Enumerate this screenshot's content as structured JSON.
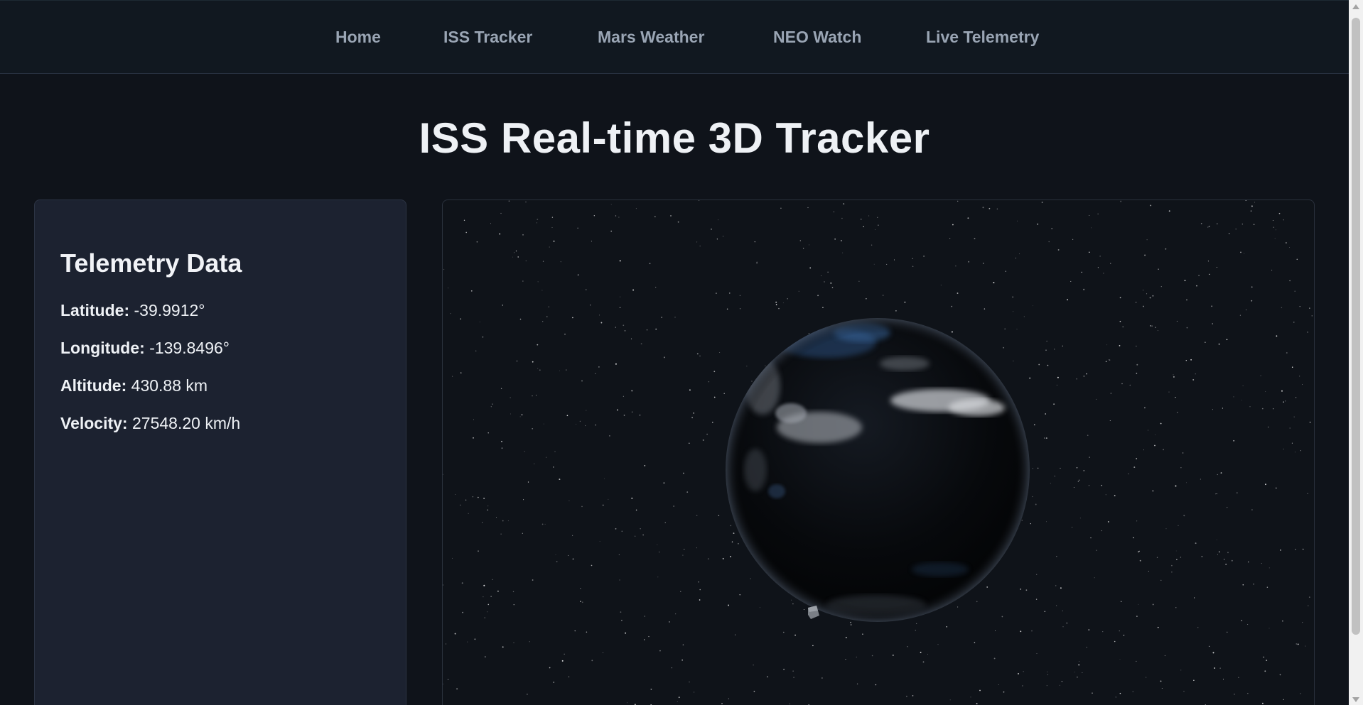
{
  "nav": {
    "items": [
      {
        "label": "Home"
      },
      {
        "label": "ISS Tracker"
      },
      {
        "label": "Mars Weather"
      },
      {
        "label": "NEO Watch"
      },
      {
        "label": "Live Telemetry"
      }
    ]
  },
  "main": {
    "title": "ISS Real-time 3D Tracker"
  },
  "telemetry": {
    "title": "Telemetry Data",
    "latitude": {
      "label": "Latitude:",
      "value": "-39.9912°"
    },
    "longitude": {
      "label": "Longitude:",
      "value": "-139.8496°"
    },
    "altitude": {
      "label": "Altitude:",
      "value": "430.88 km"
    },
    "velocity": {
      "label": "Velocity:",
      "value": "27548.20 km/h"
    }
  },
  "viewport": {
    "objects": [
      "earth-globe",
      "iss-model",
      "starfield"
    ]
  },
  "colors": {
    "background": "#0f131a",
    "panel": "#1c2230",
    "nav_text": "#9aa5b4",
    "heading": "#eef1f5"
  }
}
